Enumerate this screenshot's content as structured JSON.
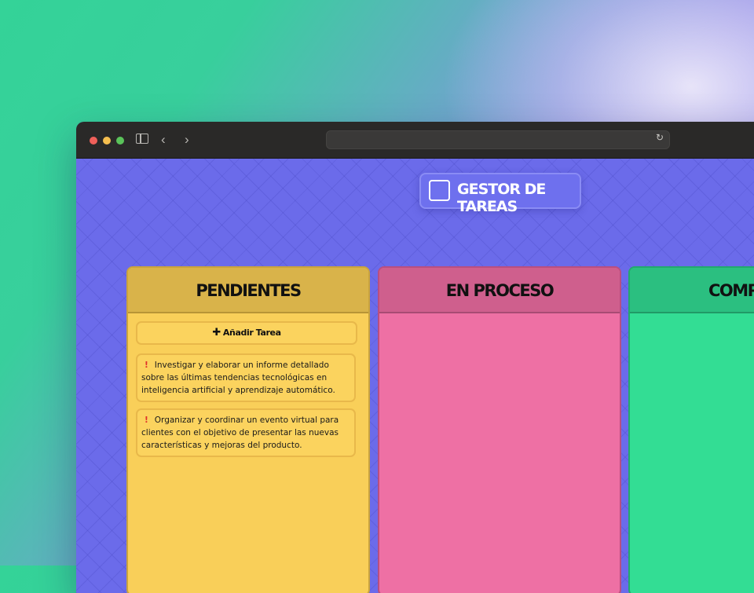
{
  "app": {
    "title": "GESTOR DE TAREAS"
  },
  "browser": {
    "url": ""
  },
  "columns": [
    {
      "title": "PENDIENTES",
      "add_button_label": "Añadir Tarea",
      "tasks": [
        {
          "icon": "!",
          "text": "Investigar y elaborar un informe detallado sobre las últimas tendencias tecnológicas en inteligencia artificial y aprendizaje automático."
        },
        {
          "icon": "!",
          "text": "Organizar y coordinar un evento virtual para clientes con el objetivo de presentar las nuevas características y mejoras del producto."
        }
      ]
    },
    {
      "title": "EN PROCESO",
      "tasks": []
    },
    {
      "title": "COMPLE",
      "tasks": []
    }
  ],
  "colors": {
    "pending": "#f9cf59",
    "in_progress": "#ee70a4",
    "completed": "#33dd94",
    "background": "#6b6bea"
  }
}
